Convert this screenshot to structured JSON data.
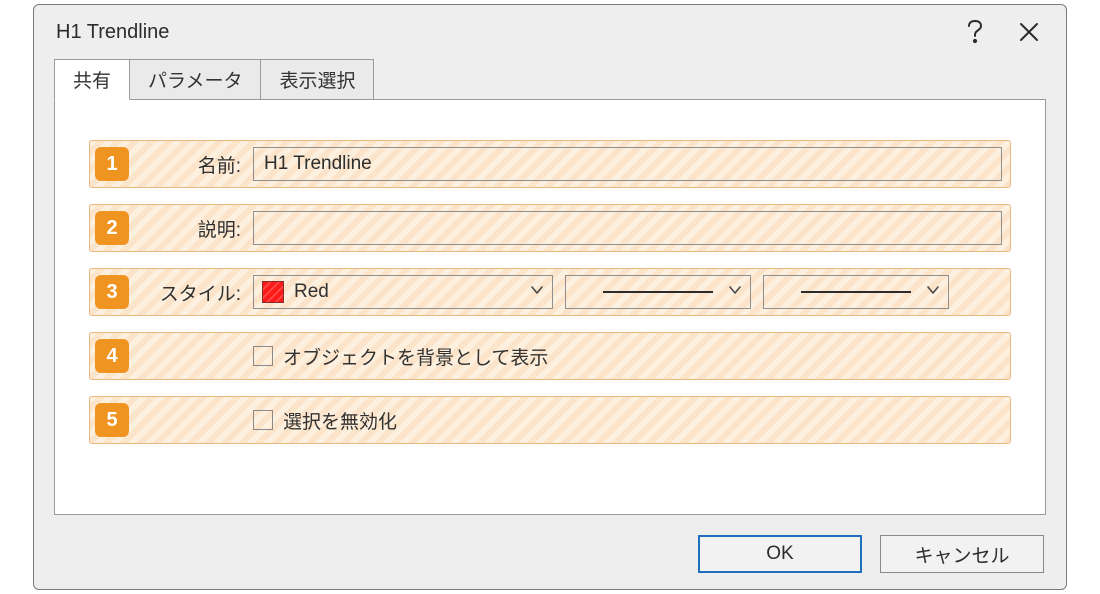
{
  "window": {
    "title": "H1 Trendline"
  },
  "tabs": {
    "t1": "共有",
    "t2": "パラメータ",
    "t3": "表示選択"
  },
  "rows": {
    "r1": {
      "num": "1",
      "label": "名前:",
      "value": "H1 Trendline"
    },
    "r2": {
      "num": "2",
      "label": "説明:",
      "value": ""
    },
    "r3": {
      "num": "3",
      "label": "スタイル:",
      "color_name": "Red",
      "color_hex": "#ff1a1a"
    },
    "r4": {
      "num": "4",
      "check_label": "オブジェクトを背景として表示"
    },
    "r5": {
      "num": "5",
      "check_label": "選択を無効化"
    }
  },
  "buttons": {
    "ok": "OK",
    "cancel": "キャンセル"
  }
}
